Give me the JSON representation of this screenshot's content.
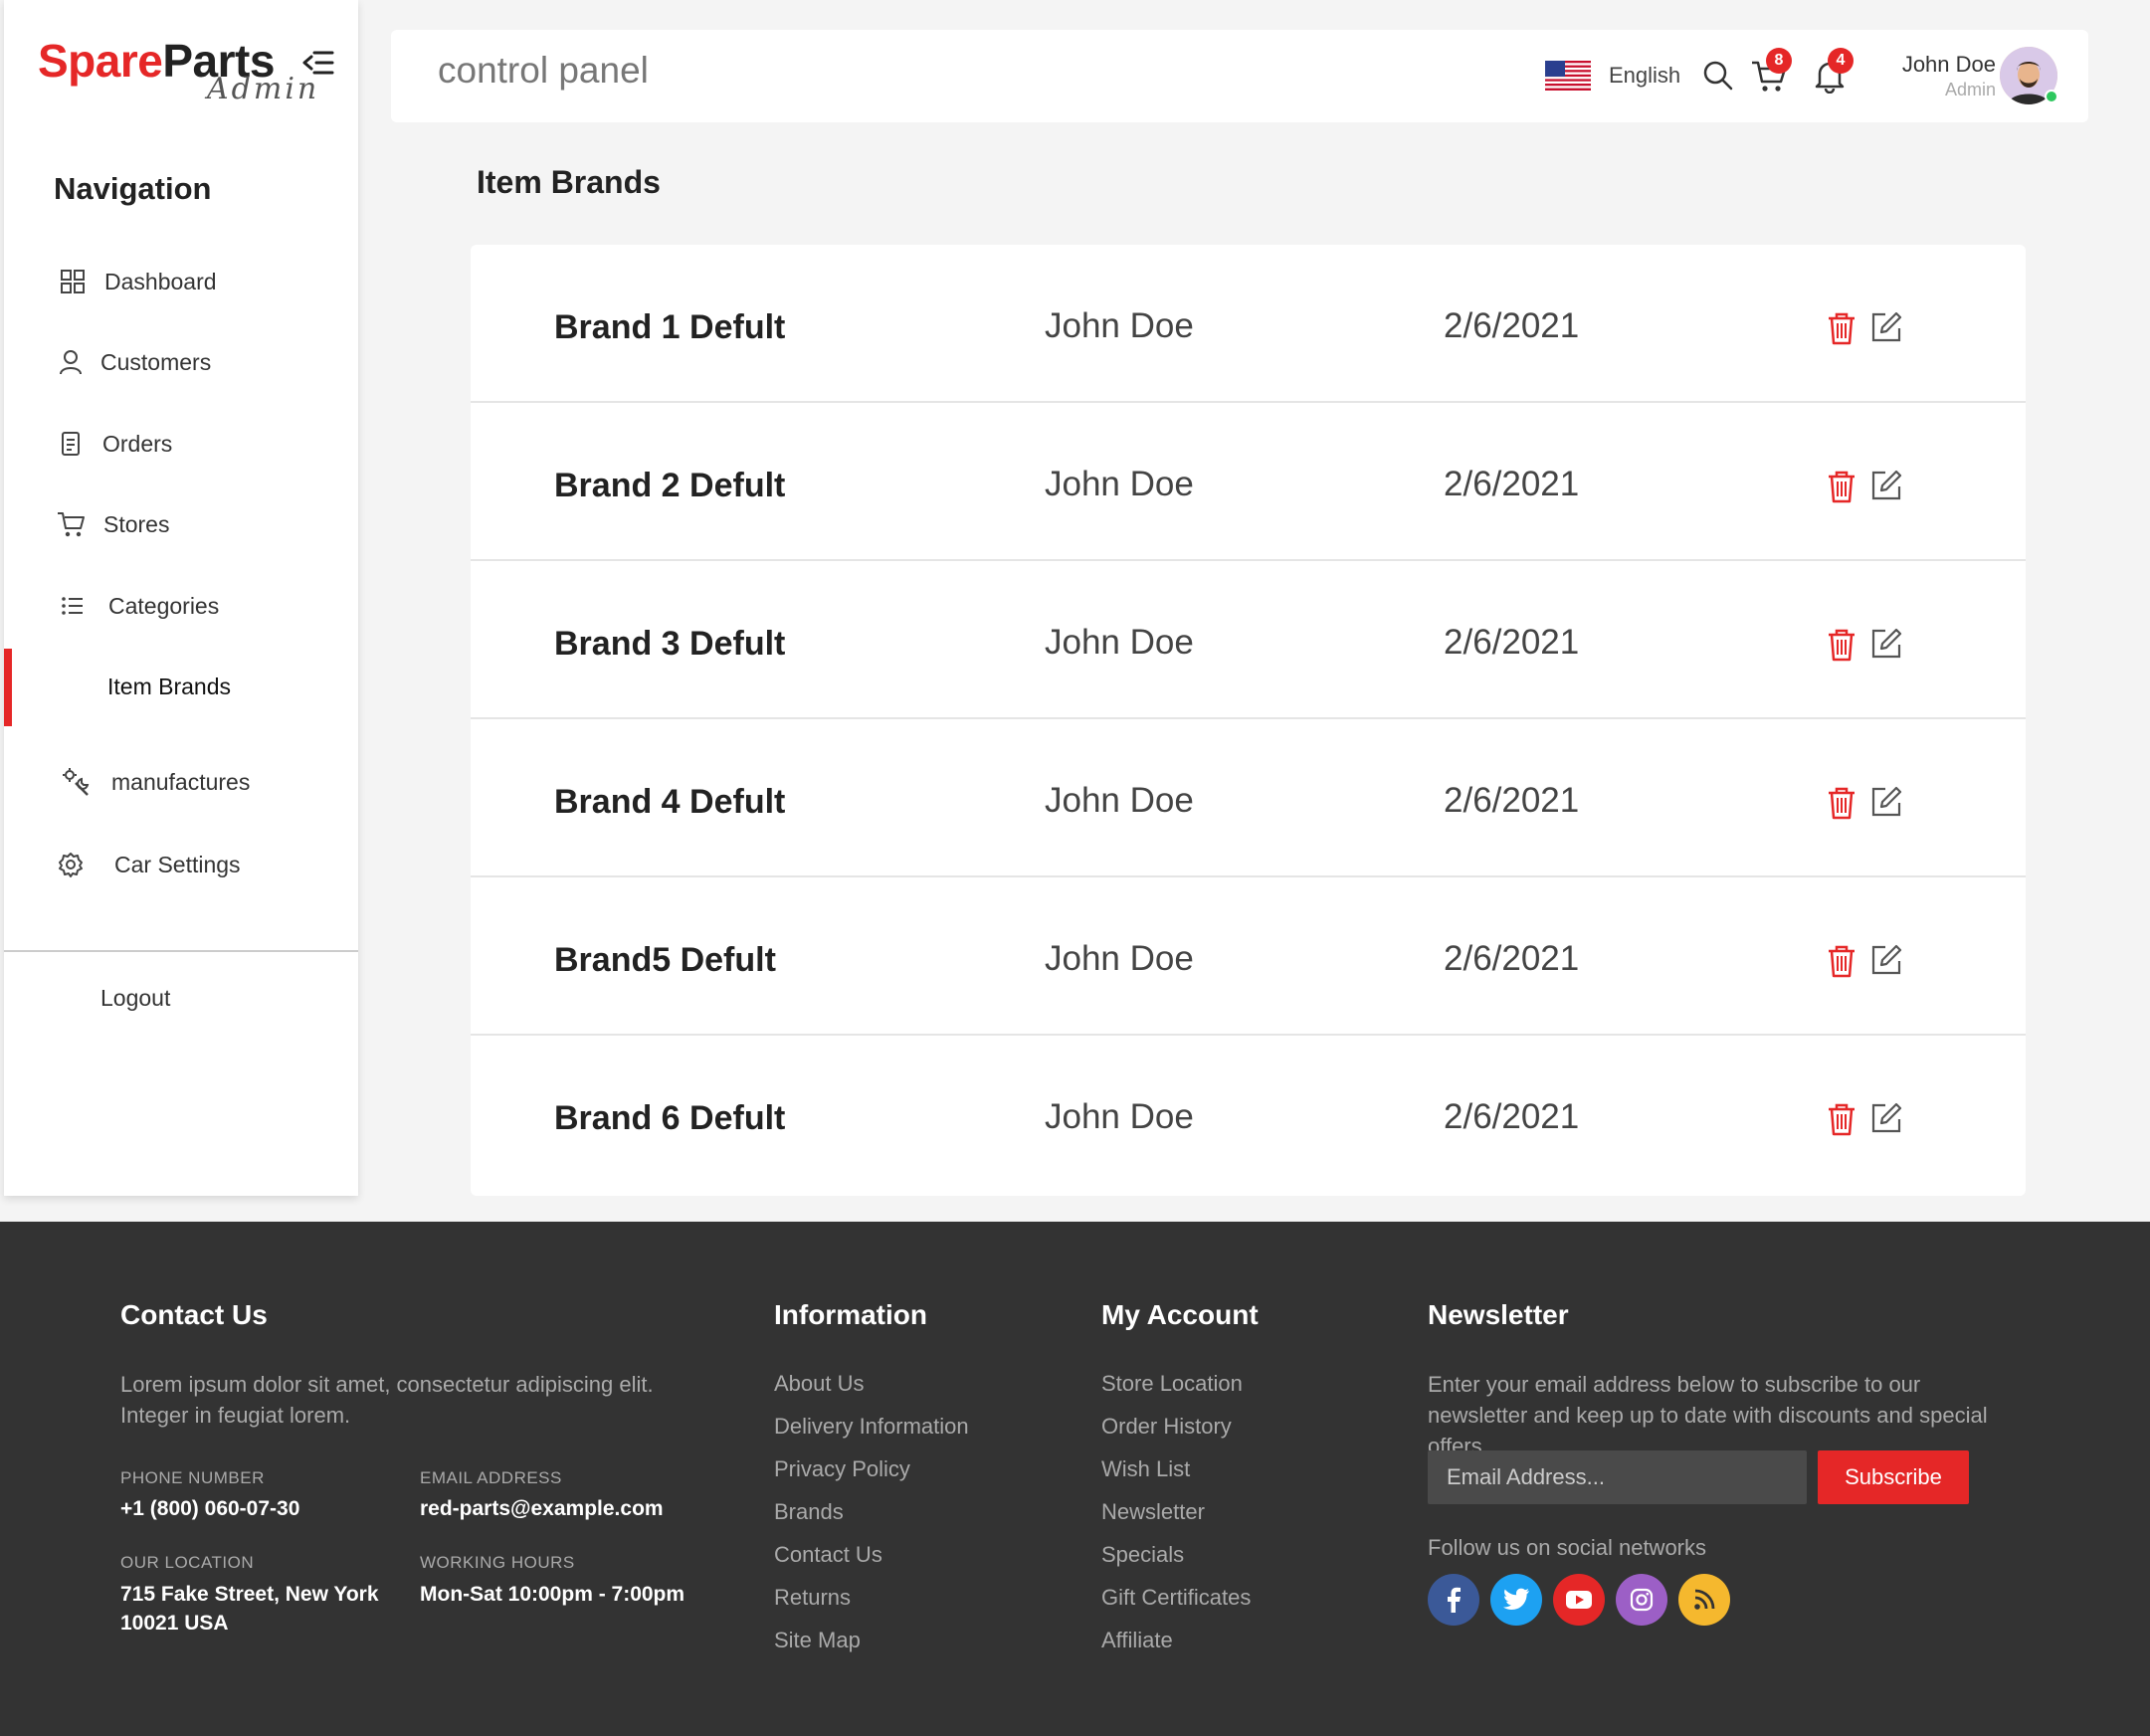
{
  "brand": {
    "name_red": "Spare",
    "name_dark": "Parts",
    "subtitle": "Admin"
  },
  "sidebar": {
    "title": "Navigation",
    "items": [
      {
        "label": "Dashboard",
        "icon": "dashboard-icon"
      },
      {
        "label": "Customers",
        "icon": "user-icon"
      },
      {
        "label": "Orders",
        "icon": "document-icon"
      },
      {
        "label": "Stores",
        "icon": "cart-icon"
      },
      {
        "label": "Categories",
        "icon": "list-icon"
      },
      {
        "label": "Item Brands",
        "icon": "",
        "active": true
      },
      {
        "label": "manufactures",
        "icon": "tools-icon"
      },
      {
        "label": "Car Settings",
        "icon": "gear-icon"
      }
    ],
    "logout": "Logout"
  },
  "header": {
    "title": "control panel",
    "language": "English",
    "cart_count": "8",
    "notification_count": "4",
    "user_name": "John Doe",
    "user_role": "Admin"
  },
  "main": {
    "title": "Item Brands",
    "rows": [
      {
        "brand": "Brand 1 Defult",
        "user": "John Doe",
        "date": "2/6/2021"
      },
      {
        "brand": "Brand 2 Defult",
        "user": "John Doe",
        "date": "2/6/2021"
      },
      {
        "brand": "Brand 3 Defult",
        "user": "John Doe",
        "date": "2/6/2021"
      },
      {
        "brand": "Brand 4 Defult",
        "user": "John Doe",
        "date": "2/6/2021"
      },
      {
        "brand": "Brand5 Defult",
        "user": "John Doe",
        "date": "2/6/2021"
      },
      {
        "brand": "Brand 6 Defult",
        "user": "John Doe",
        "date": "2/6/2021"
      }
    ]
  },
  "footer": {
    "contact": {
      "title": "Contact Us",
      "text": "Lorem ipsum dolor sit amet, consectetur adipiscing elit. Integer in feugiat lorem.",
      "phone_label": "Phone Number",
      "phone": "+1 (800) 060-07-30",
      "email_label": "Email Address",
      "email": "red-parts@example.com",
      "location_label": "Our Location",
      "location": "715 Fake Street, New York 10021 USA",
      "hours_label": "Working Hours",
      "hours": "Mon-Sat 10:00pm - 7:00pm"
    },
    "information": {
      "title": "Information",
      "links": [
        "About Us",
        "Delivery Information",
        "Privacy Policy",
        "Brands",
        "Contact Us",
        "Returns",
        "Site Map"
      ]
    },
    "account": {
      "title": "My Account",
      "links": [
        "Store Location",
        "Order History",
        "Wish List",
        "Newsletter",
        "Specials",
        "Gift Certificates",
        "Affiliate"
      ]
    },
    "newsletter": {
      "title": "Newsletter",
      "text": "Enter your email address below to subscribe to our newsletter and keep up to date with discounts and special offers.",
      "placeholder": "Email Address...",
      "button": "Subscribe",
      "follow": "Follow us on social networks"
    }
  },
  "colors": {
    "accent": "#e52727",
    "footer_bg": "#333333",
    "facebook": "#3b5998",
    "twitter": "#1da1f2",
    "youtube": "#e52727",
    "instagram": "#9c5fc6",
    "rss": "#f5b82e"
  }
}
